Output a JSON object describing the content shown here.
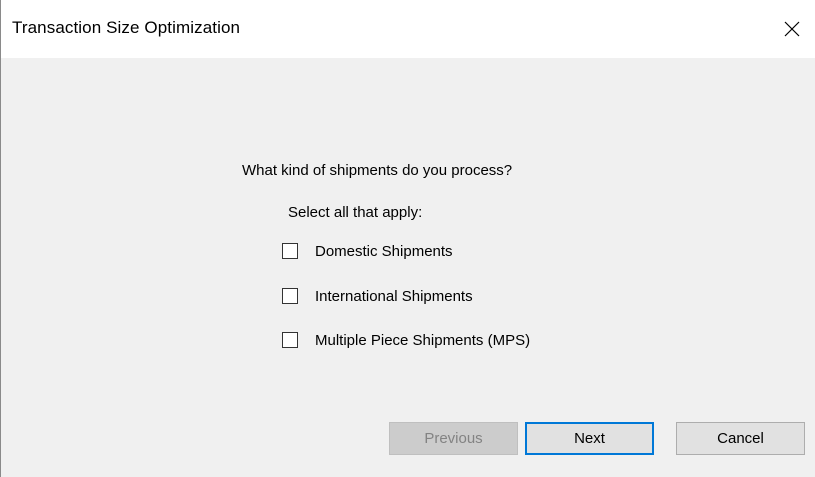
{
  "window": {
    "title": "Transaction Size Optimization",
    "close_icon": "close-icon"
  },
  "content": {
    "question": "What kind of shipments do you process?",
    "instruction": "Select all that apply:",
    "options": [
      {
        "label": "Domestic Shipments",
        "checked": false
      },
      {
        "label": "International Shipments",
        "checked": false
      },
      {
        "label": "Multiple Piece Shipments (MPS)",
        "checked": false
      }
    ]
  },
  "buttons": {
    "previous": {
      "label": "Previous",
      "enabled": false
    },
    "next": {
      "label": "Next",
      "enabled": true,
      "default": true
    },
    "cancel": {
      "label": "Cancel",
      "enabled": true
    }
  },
  "colors": {
    "dialog_background": "#f0f0f0",
    "titlebar_background": "#ffffff",
    "default_button_border": "#0078d7",
    "disabled_text": "#838383"
  }
}
